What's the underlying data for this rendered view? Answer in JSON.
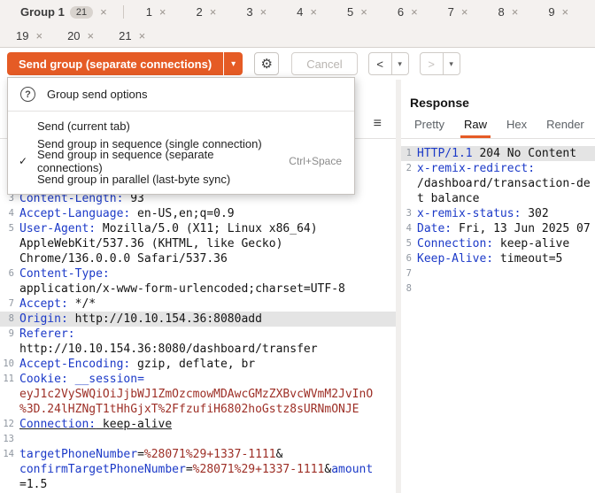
{
  "colors": {
    "accent": "#e55b25",
    "header_name": "#1c3ac8",
    "encoded_value": "#9d2f26",
    "selection_bg": "#e4e4e4"
  },
  "icons": {
    "close": "×",
    "check": "✓",
    "caret": "▾",
    "gear": "⚙",
    "back": "<",
    "forward": ">",
    "editor_menu": "≡"
  },
  "tabbar": {
    "group_tab": {
      "label": "Group 1",
      "badge": "21"
    },
    "row1_tabs": [
      "1",
      "2",
      "3",
      "4",
      "5",
      "6",
      "7",
      "8",
      "9"
    ],
    "partial_tab": "1",
    "row2_tabs": [
      "19",
      "20",
      "21"
    ]
  },
  "toolbar": {
    "send_label": "Send group (separate connections)",
    "cancel_label": "Cancel"
  },
  "menu": {
    "help_glyph": "?",
    "title": "Group send options",
    "items": [
      {
        "label": "Send (current tab)",
        "checked": false,
        "shortcut": ""
      },
      {
        "label": "Send group in sequence (single connection)",
        "checked": false,
        "shortcut": ""
      },
      {
        "label": "Send group in sequence (separate connections)",
        "checked": true,
        "shortcut": "Ctrl+Space"
      },
      {
        "label": "Send group in parallel (last-byte sync)",
        "checked": false,
        "shortcut": ""
      }
    ]
  },
  "request_editor": {
    "lines": [
      {
        "n": "3",
        "s": [
          {
            "t": "Content-Length:",
            "c": "k"
          },
          {
            "t": " 93",
            "c": "p"
          }
        ]
      },
      {
        "n": "4",
        "s": [
          {
            "t": "Accept-Language:",
            "c": "k"
          },
          {
            "t": " en-US,en;q=0.9",
            "c": "p"
          }
        ]
      },
      {
        "n": "5",
        "s": [
          {
            "t": "User-Agent:",
            "c": "k"
          },
          {
            "t": " Mozilla/5.0 (X11; Linux x86_64)",
            "c": "p"
          }
        ]
      },
      {
        "n": "",
        "s": [
          {
            "t": "AppleWebKit/537.36 (KHTML, like Gecko)",
            "c": "p"
          }
        ]
      },
      {
        "n": "",
        "s": [
          {
            "t": "Chrome/136.0.0.0 Safari/537.36",
            "c": "p"
          }
        ]
      },
      {
        "n": "6",
        "s": [
          {
            "t": "Content-Type:",
            "c": "k"
          }
        ]
      },
      {
        "n": "",
        "s": [
          {
            "t": "application/x-www-form-urlencoded;charset=UTF-8",
            "c": "p"
          }
        ]
      },
      {
        "n": "7",
        "s": [
          {
            "t": "Accept:",
            "c": "k"
          },
          {
            "t": " */*",
            "c": "p"
          }
        ]
      },
      {
        "n": "8",
        "hl": true,
        "s": [
          {
            "t": "Origin:",
            "c": "k"
          },
          {
            "t": " http://10.10.154.36:8080add",
            "c": "p"
          }
        ]
      },
      {
        "n": "9",
        "s": [
          {
            "t": "Referer:",
            "c": "k"
          }
        ]
      },
      {
        "n": "",
        "s": [
          {
            "t": "http://10.10.154.36:8080/dashboard/transfer",
            "c": "p"
          }
        ]
      },
      {
        "n": "10",
        "s": [
          {
            "t": "Accept-Encoding:",
            "c": "k"
          },
          {
            "t": " gzip, deflate, br",
            "c": "p"
          }
        ]
      },
      {
        "n": "11",
        "s": [
          {
            "t": "Cookie:",
            "c": "k"
          },
          {
            "t": " ",
            "c": "p"
          },
          {
            "t": "__session=",
            "c": "k"
          }
        ]
      },
      {
        "n": "",
        "s": [
          {
            "t": "eyJ1c2VySWQiOiJjbWJ1ZmOzcmowMDAwcGMzZXBvcWVmM2JvInO",
            "c": "r"
          }
        ]
      },
      {
        "n": "",
        "s": [
          {
            "t": "%3D.24lHZNgT1tHhGjxT%2FfzufiH6802hoGstz8sURNmONJE",
            "c": "r"
          }
        ]
      },
      {
        "n": "12",
        "ul": true,
        "s": [
          {
            "t": "Connection:",
            "c": "k"
          },
          {
            "t": " keep-alive",
            "c": "p"
          }
        ]
      },
      {
        "n": "13",
        "s": []
      },
      {
        "n": "14",
        "s": [
          {
            "t": "targetPhoneNumber",
            "c": "k"
          },
          {
            "t": "=",
            "c": "p"
          },
          {
            "t": "%28071%29+1337-1111",
            "c": "r"
          },
          {
            "t": "&",
            "c": "p"
          }
        ]
      },
      {
        "n": "",
        "s": [
          {
            "t": "confirmTargetPhoneNumber",
            "c": "k"
          },
          {
            "t": "=",
            "c": "p"
          },
          {
            "t": "%28071%29+1337-1111",
            "c": "r"
          },
          {
            "t": "&",
            "c": "p"
          },
          {
            "t": "amount",
            "c": "k"
          }
        ]
      },
      {
        "n": "",
        "s": [
          {
            "t": "=1.5",
            "c": "p"
          }
        ]
      }
    ]
  },
  "response_panel": {
    "title": "Response",
    "tabs": [
      {
        "label": "Pretty",
        "active": false
      },
      {
        "label": "Raw",
        "active": true
      },
      {
        "label": "Hex",
        "active": false
      },
      {
        "label": "Render",
        "active": false
      }
    ],
    "lines": [
      {
        "n": "1",
        "hl": true,
        "s": [
          {
            "t": "HTTP/1.1",
            "c": "k"
          },
          {
            "t": " 204 No Content",
            "c": "p"
          }
        ]
      },
      {
        "n": "2",
        "s": [
          {
            "t": "x-remix-redirect:",
            "c": "k"
          }
        ]
      },
      {
        "n": "",
        "s": [
          {
            "t": "/dashboard/transaction-de",
            "c": "p"
          }
        ]
      },
      {
        "n": "",
        "s": [
          {
            "t": "t balance",
            "c": "p"
          }
        ]
      },
      {
        "n": "3",
        "s": [
          {
            "t": "x-remix-status:",
            "c": "k"
          },
          {
            "t": " 302",
            "c": "p"
          }
        ]
      },
      {
        "n": "4",
        "s": [
          {
            "t": "Date:",
            "c": "k"
          },
          {
            "t": " Fri, 13 Jun 2025 07",
            "c": "p"
          }
        ]
      },
      {
        "n": "5",
        "s": [
          {
            "t": "Connection:",
            "c": "k"
          },
          {
            "t": " keep-alive",
            "c": "p"
          }
        ]
      },
      {
        "n": "6",
        "s": [
          {
            "t": "Keep-Alive:",
            "c": "k"
          },
          {
            "t": " timeout=5",
            "c": "p"
          }
        ]
      },
      {
        "n": "7",
        "s": []
      },
      {
        "n": "8",
        "s": []
      }
    ]
  }
}
